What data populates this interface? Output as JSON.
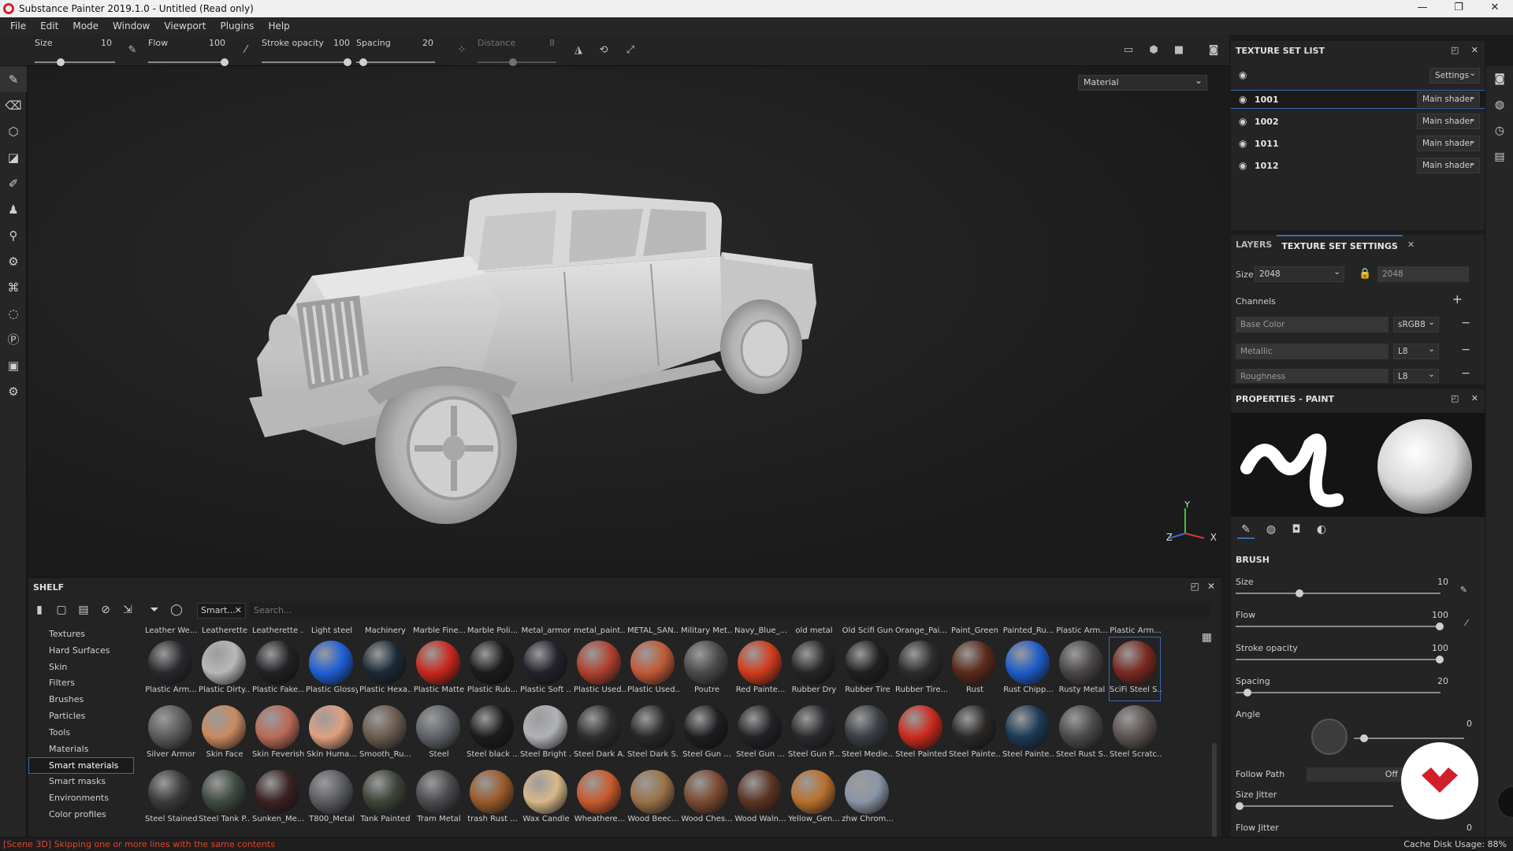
{
  "window": {
    "title": "Substance Painter 2019.1.0 - Untitled (Read only)",
    "controls": [
      "—",
      "❐",
      "✕"
    ]
  },
  "menu": [
    "File",
    "Edit",
    "Mode",
    "Window",
    "Viewport",
    "Plugins",
    "Help"
  ],
  "toolbar": {
    "size_label": "Size",
    "size_value": "10",
    "flow_label": "Flow",
    "flow_value": "100",
    "stroke_opacity_label": "Stroke opacity",
    "stroke_opacity_value": "100",
    "spacing_label": "Spacing",
    "spacing_value": "20",
    "distance_label": "Distance",
    "distance_value": "8"
  },
  "viewport": {
    "display_mode": "Material",
    "axis_labels": {
      "x": "X",
      "y": "Y",
      "z": "Z"
    }
  },
  "texture_set_list": {
    "title": "TEXTURE SET LIST",
    "settings_label": "Settings",
    "rows": [
      {
        "id": "1001",
        "shader": "Main shader"
      },
      {
        "id": "1002",
        "shader": "Main shader"
      },
      {
        "id": "1011",
        "shader": "Main shader"
      },
      {
        "id": "1012",
        "shader": "Main shader"
      }
    ]
  },
  "texture_set_settings": {
    "tab_layers": "LAYERS",
    "tab_settings": "TEXTURE SET SETTINGS",
    "size_label": "Size",
    "size_value": "2048",
    "size_locked_value": "2048",
    "channels_label": "Channels",
    "channels": [
      {
        "name": "Base Color",
        "format": "sRGB8"
      },
      {
        "name": "Metallic",
        "format": "L8"
      },
      {
        "name": "Roughness",
        "format": "L8"
      }
    ]
  },
  "properties": {
    "title": "PROPERTIES - PAINT",
    "section_brush": "BRUSH",
    "size_label": "Size",
    "size_value": "10",
    "flow_label": "Flow",
    "flow_value": "100",
    "stroke_opacity_label": "Stroke opacity",
    "stroke_opacity_value": "100",
    "spacing_label": "Spacing",
    "spacing_value": "20",
    "angle_label": "Angle",
    "angle_value": "0",
    "follow_path_label": "Follow Path",
    "follow_path_value": "Off",
    "size_jitter_label": "Size Jitter",
    "flow_jitter_label": "Flow Jitter",
    "flow_jitter_value": "0"
  },
  "shelf": {
    "title": "SHELF",
    "filter_chip": "Smart...",
    "search_placeholder": "Search...",
    "categories": [
      "Textures",
      "Hard Surfaces",
      "Skin",
      "Filters",
      "Brushes",
      "Particles",
      "Tools",
      "Materials",
      "Smart materials",
      "Smart masks",
      "Environments",
      "Color profiles"
    ],
    "active_category": "Smart materials",
    "top_labels": [
      "Leather We...",
      "Leatherette",
      "Leatherette ...",
      "Light steel",
      "Machinery",
      "Marble Fine...",
      "Marble Poli...",
      "Metal_armor",
      "metal_paint...",
      "METAL_SAN...",
      "Military Met...",
      "Navy_Blue_...",
      "old metal",
      "Old Scifi Gun",
      "Orange_Pai...",
      "Paint_Green",
      "Painted_Ru...",
      "Plastic Arm...",
      "Plastic Arm..."
    ],
    "row1": [
      {
        "name": "Plastic Arm...",
        "color": "#2a2a2e"
      },
      {
        "name": "Plastic Dirty...",
        "color": "#b8b8b8"
      },
      {
        "name": "Plastic Fake...",
        "color": "#222226"
      },
      {
        "name": "Plastic Glossy",
        "color": "#1f5fd6"
      },
      {
        "name": "Plastic Hexa...",
        "color": "#1b2a36"
      },
      {
        "name": "Plastic Matte",
        "color": "#c8281e"
      },
      {
        "name": "Plastic Rub...",
        "color": "#1c1c1e"
      },
      {
        "name": "Plastic Soft ...",
        "color": "#23222c"
      },
      {
        "name": "Plastic Used...",
        "color": "#b04030"
      },
      {
        "name": "Plastic Used...",
        "color": "#c05a38"
      },
      {
        "name": "Poutre",
        "color": "#4a4a4a"
      },
      {
        "name": "Red Painte...",
        "color": "#d13c1c"
      },
      {
        "name": "Rubber Dry",
        "color": "#262628"
      },
      {
        "name": "Rubber Tire",
        "color": "#202022"
      },
      {
        "name": "Rubber Tire...",
        "color": "#2c2c2c"
      },
      {
        "name": "Rust",
        "color": "#5a2a1c"
      },
      {
        "name": "Rust Chipp...",
        "color": "#1d5cc8"
      },
      {
        "name": "Rusty Metal",
        "color": "#4a4648"
      },
      {
        "name": "SciFi Steel S...",
        "color": "#7a2a22"
      }
    ],
    "row2": [
      {
        "name": "Silver Armor",
        "color": "#5a5a5a"
      },
      {
        "name": "Skin Face",
        "color": "#c88a60"
      },
      {
        "name": "Skin Feverish",
        "color": "#b86a58"
      },
      {
        "name": "Skin Huma...",
        "color": "#e0a080"
      },
      {
        "name": "Smooth_Ru...",
        "color": "#6a5a4e"
      },
      {
        "name": "Steel",
        "color": "#5e6268"
      },
      {
        "name": "Steel black ...",
        "color": "#1c1c1c"
      },
      {
        "name": "Steel Bright ...",
        "color": "#b0b2b6"
      },
      {
        "name": "Steel Dark A...",
        "color": "#2e2e2e"
      },
      {
        "name": "Steel Dark S...",
        "color": "#282828"
      },
      {
        "name": "Steel Gun ...",
        "color": "#1e1e22"
      },
      {
        "name": "Steel Gun ...",
        "color": "#222226"
      },
      {
        "name": "Steel Gun P...",
        "color": "#2a2a2e"
      },
      {
        "name": "Steel Medie...",
        "color": "#3a3e44"
      },
      {
        "name": "Steel Painted",
        "color": "#cc2a1e"
      },
      {
        "name": "Steel Painte...",
        "color": "#2a2826"
      },
      {
        "name": "Steel Painte...",
        "color": "#1c3a56"
      },
      {
        "name": "Steel Rust S...",
        "color": "#4a4a4c"
      },
      {
        "name": "Steel Scratc...",
        "color": "#5a5250"
      }
    ],
    "row3": [
      {
        "name": "Steel Stained",
        "color": "#3a3a3c"
      },
      {
        "name": "Steel Tank P...",
        "color": "#3e4a40"
      },
      {
        "name": "Sunken_Me...",
        "color": "#3a2222"
      },
      {
        "name": "T800_Metal",
        "color": "#5a5c62"
      },
      {
        "name": "Tank Painted",
        "color": "#3e4438"
      },
      {
        "name": "Tram Metal",
        "color": "#4a4a4e"
      },
      {
        "name": "trash Rust ...",
        "color": "#9a5a2a"
      },
      {
        "name": "Wax Candle",
        "color": "#d8b88a"
      },
      {
        "name": "Wheathere...",
        "color": "#c85a2e"
      },
      {
        "name": "Wood Beec...",
        "color": "#9a7248"
      },
      {
        "name": "Wood Ches...",
        "color": "#7a4a30"
      },
      {
        "name": "Wood Waln...",
        "color": "#5a3424"
      },
      {
        "name": "Yellow_Gen...",
        "color": "#b8702e"
      },
      {
        "name": "zhw Chrom...",
        "color": "#8a96a6"
      }
    ]
  },
  "status": {
    "message": "[Scene 3D] Skipping one or more lines with the same contents",
    "cache": "Cache Disk Usage:  88%"
  },
  "colors": {
    "accent": "#3a69b3",
    "error": "#e0452b",
    "badge": "#d21e2a"
  }
}
